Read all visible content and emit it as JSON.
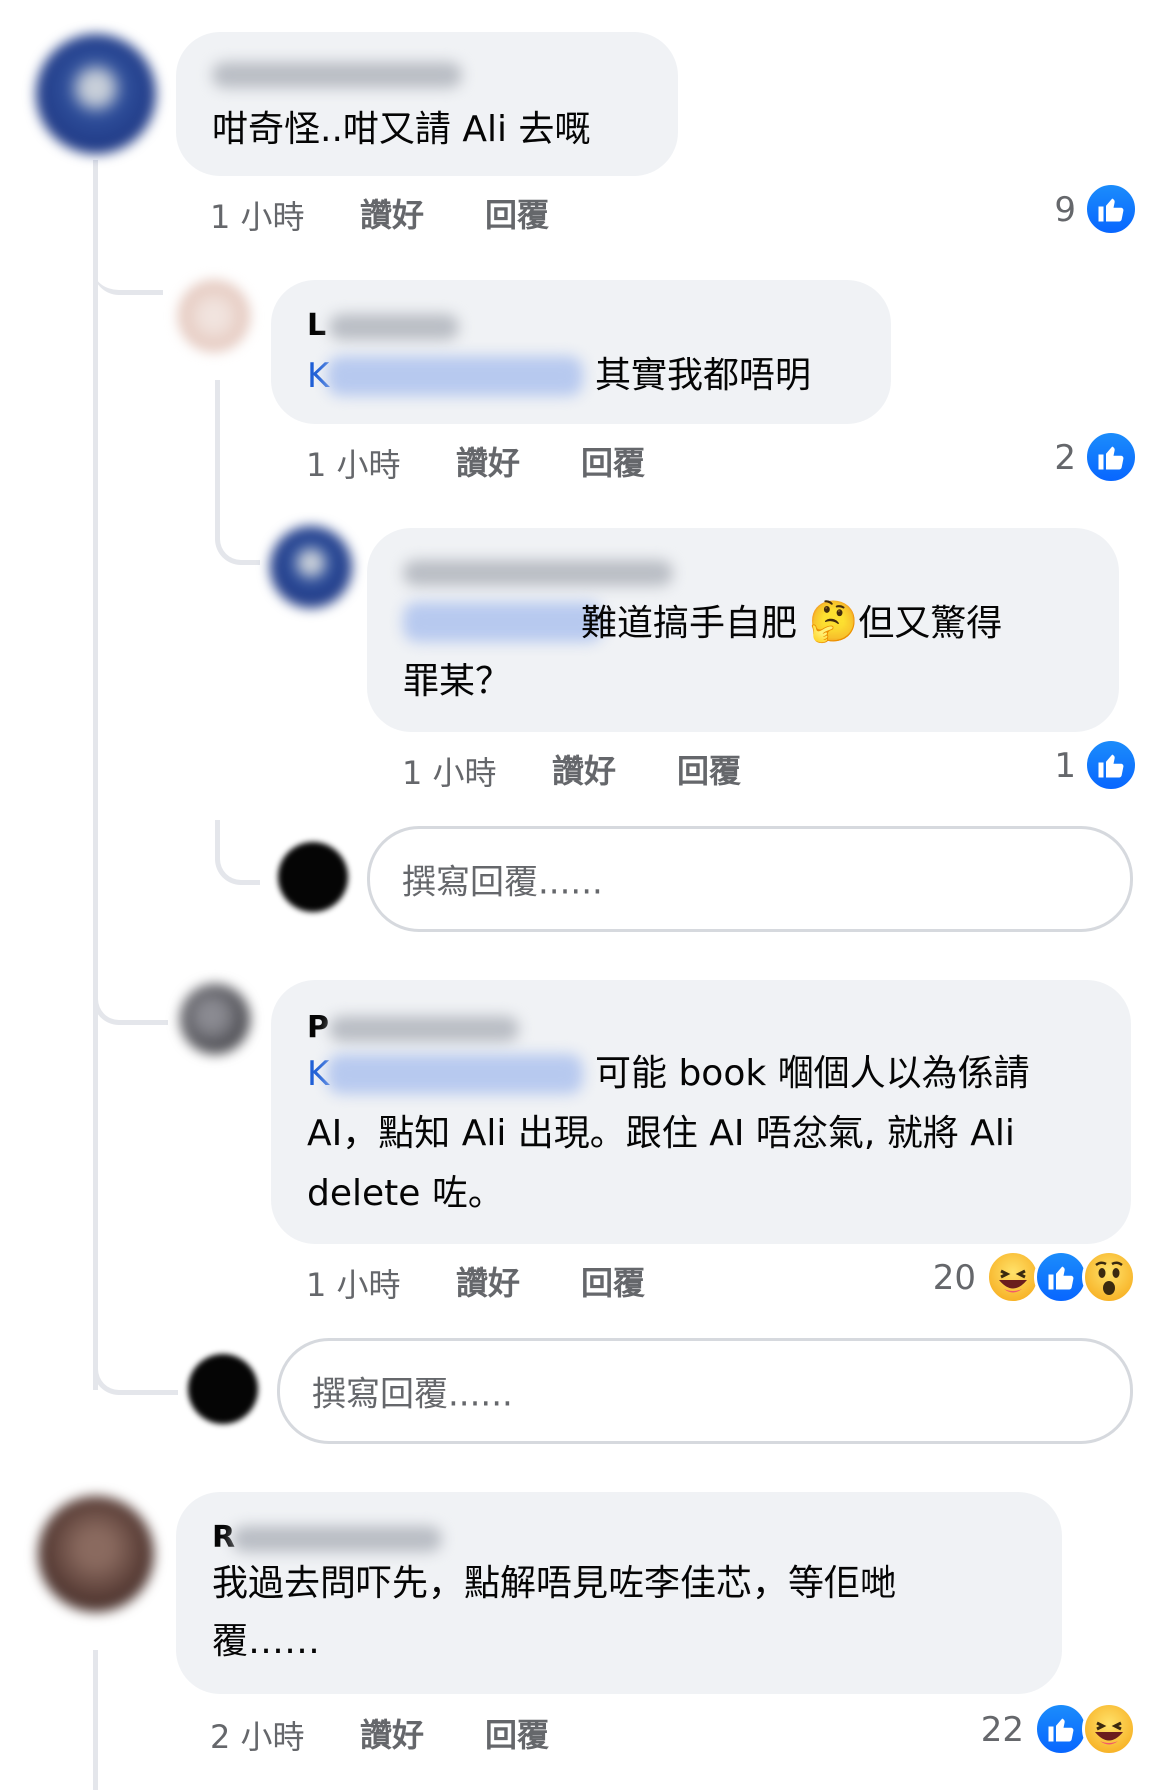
{
  "comments": [
    {
      "text": "咁奇怪..咁又請 Ali 去嘅",
      "time": "1 小時",
      "like_label": "讚好",
      "reply_label": "回覆",
      "reaction_count": "9",
      "reactions": [
        "like-icon"
      ]
    },
    {
      "name_initial": "L",
      "tag_initial": "K",
      "text": "其實我都唔明",
      "time": "1 小時",
      "like_label": "讚好",
      "reply_label": "回覆",
      "reaction_count": "2",
      "reactions": [
        "like-icon"
      ]
    },
    {
      "text_line1": "難道搞手自肥",
      "emoji": "🤔",
      "text_line1b": "但又驚得",
      "text_line2": "罪某？",
      "time": "1 小時",
      "like_label": "讚好",
      "reply_label": "回覆",
      "reaction_count": "1",
      "reactions": [
        "like-icon"
      ]
    },
    {
      "name_initial": "P",
      "tag_initial": "K",
      "text_line1": "可能 book 嗰個人以為係請",
      "text_line2": "AI，點知 Ali 出現。跟住 AI 唔忿氣, 就將 Ali",
      "text_line3": "delete 咗。",
      "time": "1 小時",
      "like_label": "讚好",
      "reply_label": "回覆",
      "reaction_count": "20",
      "reactions": [
        "haha-icon",
        "like-icon",
        "wow-icon"
      ]
    },
    {
      "name_initial": "R",
      "text_line1": "我過去問吓先，點解唔見咗李佳芯，等佢哋",
      "text_line2": "覆……",
      "time": "2 小時",
      "like_label": "讚好",
      "reply_label": "回覆",
      "reaction_count": "22",
      "reactions": [
        "like-icon",
        "haha-icon"
      ]
    }
  ],
  "composer": {
    "placeholder": "撰寫回覆......"
  }
}
